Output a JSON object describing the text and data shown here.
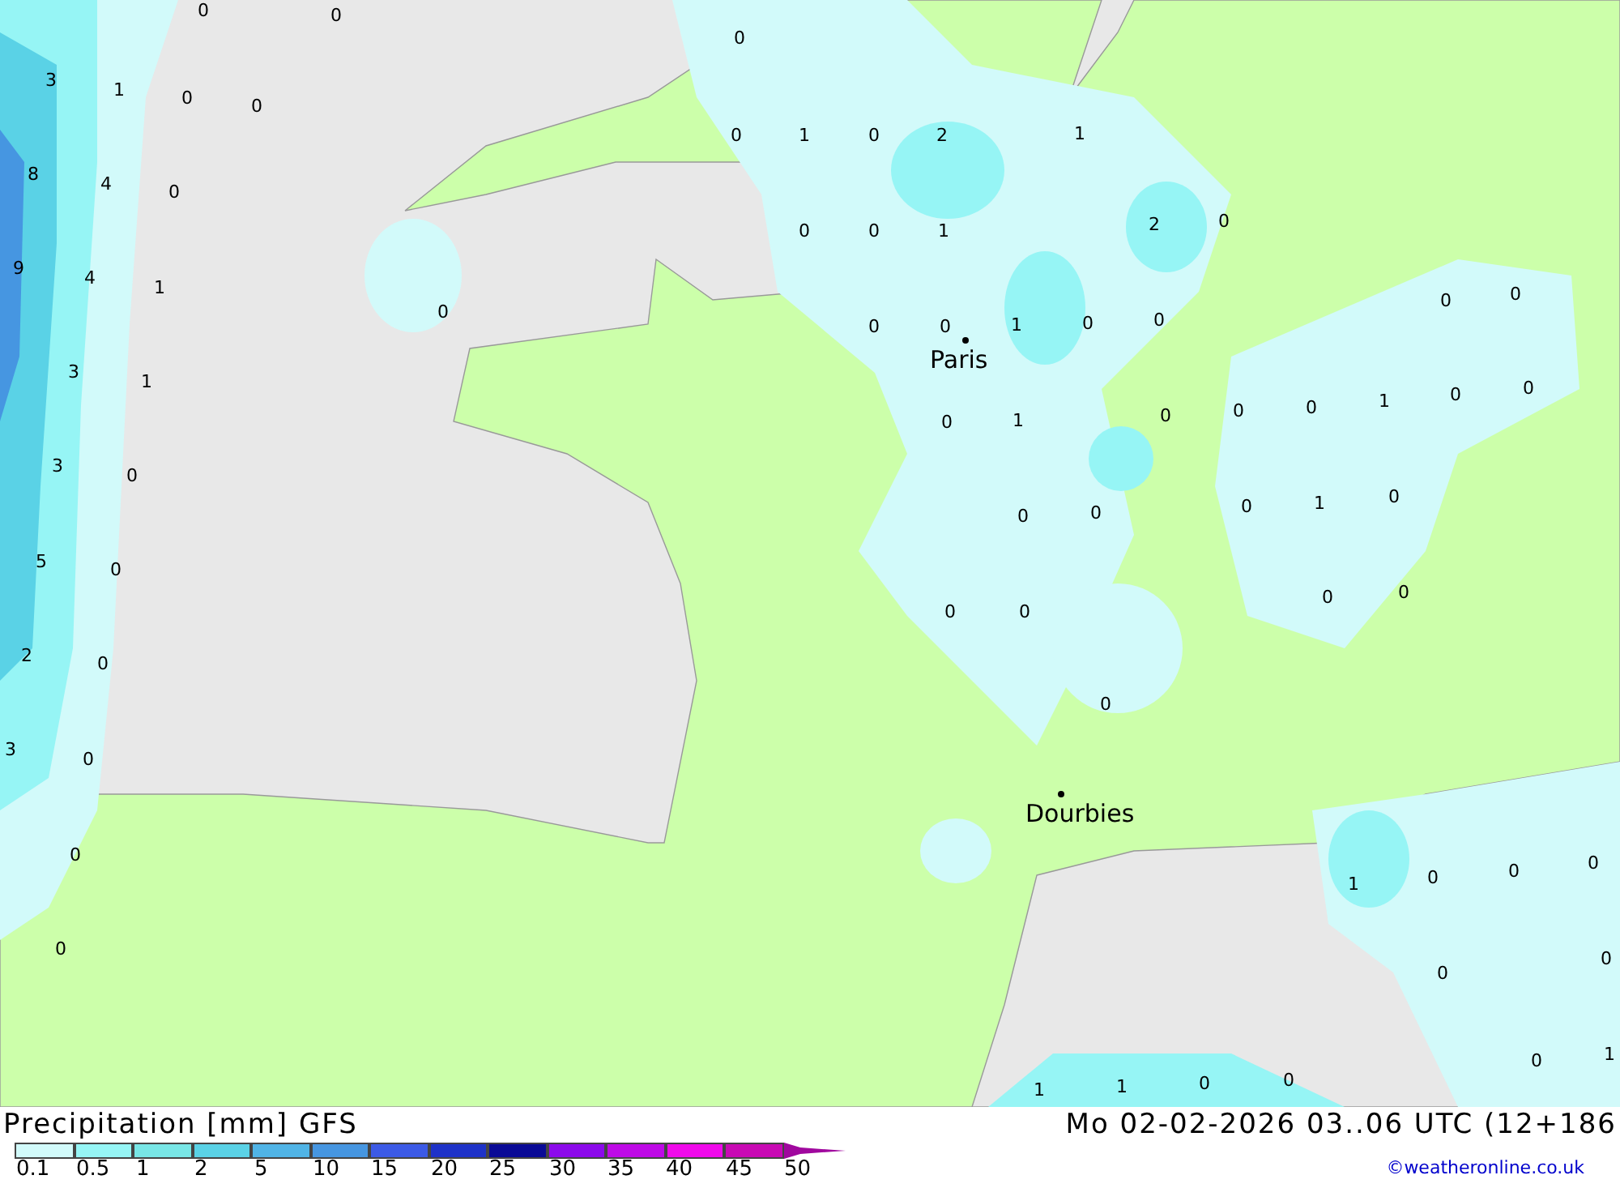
{
  "map": {
    "values": [
      "0",
      "0",
      "3",
      "1",
      "0",
      "0",
      "8",
      "4",
      "0",
      "9",
      "4",
      "1",
      "0",
      "3",
      "1",
      "3",
      "0",
      "5",
      "0",
      "2",
      "0",
      "3",
      "0",
      "0",
      "0",
      "0",
      "0",
      "1",
      "0",
      "2",
      "1",
      "0",
      "0",
      "1",
      "2",
      "0",
      "0",
      "0",
      "1",
      "0",
      "0",
      "0",
      "0",
      "0",
      "1",
      "0",
      "0",
      "0",
      "1",
      "0",
      "0",
      "0",
      "0",
      "0",
      "1",
      "0",
      "0",
      "0",
      "0",
      "0",
      "0",
      "1",
      "0",
      "0",
      "0",
      "0",
      "0",
      "0",
      "1",
      "1",
      "1",
      "0",
      "0"
    ],
    "cities": [
      {
        "name": "Paris"
      },
      {
        "name": "Dourbies"
      }
    ]
  },
  "legend": {
    "title": "Precipitation [mm] GFS",
    "valid_time": "Mo 02-02-2026 03..06 UTC (12+186",
    "swatches": [
      {
        "color": "#d2fafa"
      },
      {
        "color": "#96f5f5"
      },
      {
        "color": "#78e6e6"
      },
      {
        "color": "#5ad2e6"
      },
      {
        "color": "#50b4e6"
      },
      {
        "color": "#4696e1"
      },
      {
        "color": "#3c5ae6"
      },
      {
        "color": "#1e32c8"
      },
      {
        "color": "#0a0a96"
      },
      {
        "color": "#8c0aeb"
      },
      {
        "color": "#be0ae6"
      },
      {
        "color": "#f00aeb"
      },
      {
        "color": "#c80ab4"
      }
    ],
    "ticks": [
      "0.1",
      "0.5",
      "1",
      "2",
      "5",
      "10",
      "15",
      "20",
      "25",
      "30",
      "35",
      "40",
      "45",
      "50"
    ],
    "credit": "©weatheronline.co.uk"
  }
}
